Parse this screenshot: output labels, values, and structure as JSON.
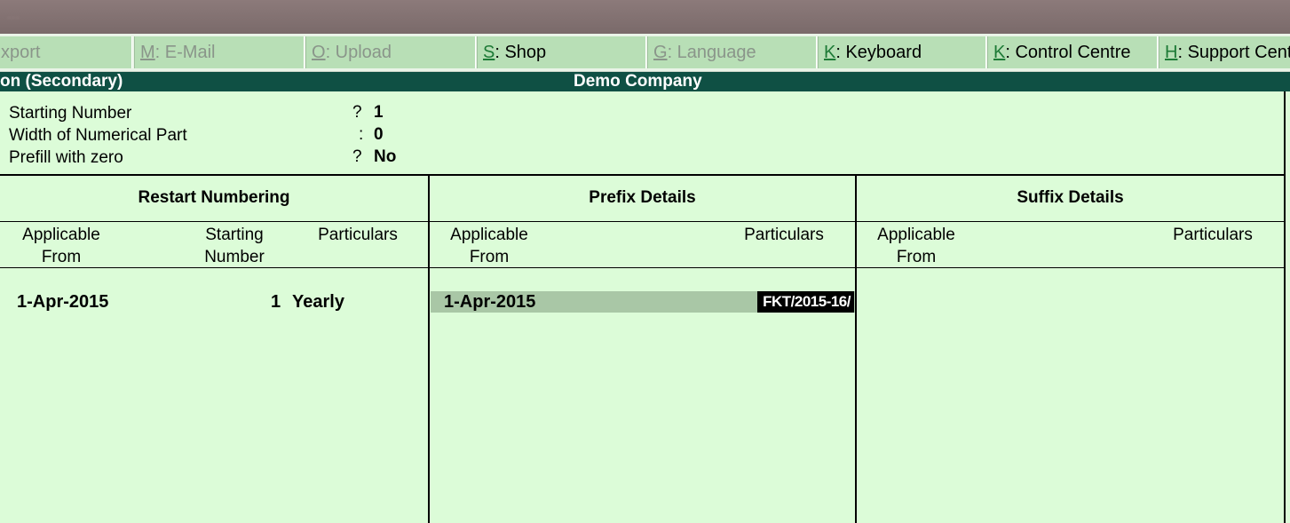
{
  "title_bar": {
    "text": "..."
  },
  "menu": [
    {
      "key": "E",
      "label": "xport",
      "prefix": "",
      "enabled": false,
      "display_key": ""
    },
    {
      "key": "M",
      "label": ": E-Mail",
      "enabled": false
    },
    {
      "key": "O",
      "label": ": Upload",
      "enabled": false
    },
    {
      "key": "S",
      "label": ": Shop",
      "enabled": true
    },
    {
      "key": "G",
      "label": ": Language",
      "enabled": false
    },
    {
      "key": "K",
      "label": ": Keyboard",
      "enabled": true
    },
    {
      "key": "K",
      "label": ": Control Centre",
      "enabled": true
    },
    {
      "key": "H",
      "label": ": Support Cent",
      "enabled": true
    }
  ],
  "header": {
    "left": "on (Secondary)",
    "center": "Demo Company"
  },
  "info": [
    {
      "label": "Starting Number",
      "sep": "?",
      "value": "1"
    },
    {
      "label": "Width of Numerical Part",
      "sep": ":",
      "value": "0"
    },
    {
      "label": "Prefill with zero",
      "sep": "?",
      "value": "No"
    }
  ],
  "sections": {
    "restart": {
      "title": "Restart Numbering",
      "col_applicable": [
        "Applicable",
        "From"
      ],
      "col_starting": [
        "Starting",
        "Number"
      ],
      "col_particulars": "Particulars",
      "row": {
        "date": "1-Apr-2015",
        "number": "1",
        "particulars": "Yearly"
      }
    },
    "prefix": {
      "title": "Prefix Details",
      "col_applicable": [
        "Applicable",
        "From"
      ],
      "col_particulars": "Particulars",
      "row": {
        "date": "1-Apr-2015",
        "particulars": "FKT/2015-16/"
      }
    },
    "suffix": {
      "title": "Suffix Details",
      "col_applicable": [
        "Applicable",
        "From"
      ],
      "col_particulars": "Particulars"
    }
  },
  "colors": {
    "background": "#dcfcd8",
    "header": "#0f5044",
    "menu_button": "#b8dfb6",
    "highlight": "#a9c7a6"
  }
}
